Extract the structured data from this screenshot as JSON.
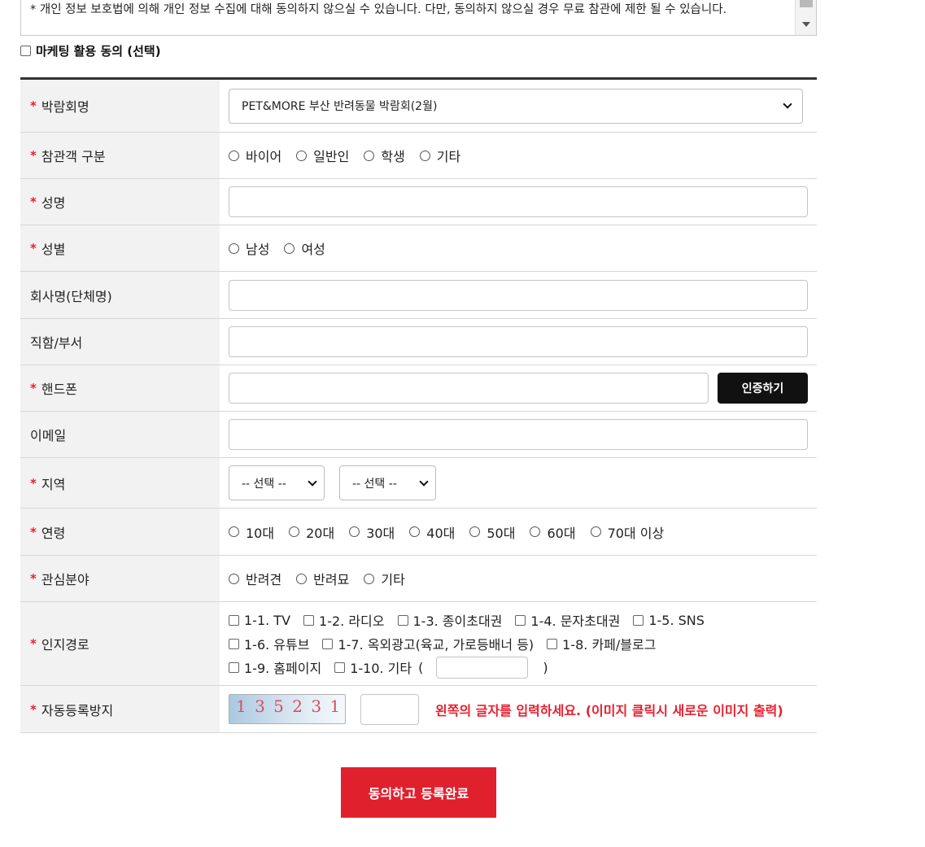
{
  "notice": {
    "text": "* 개인 정보 보호법에 의해 개인 정보 수집에 대해 동의하지 않으실 수 있습니다. 다만, 동의하지 않으실 경우 무료 참관에 제한 될 수 있습니다."
  },
  "marketing": {
    "label": "마케팅 활용 동의 (선택)"
  },
  "form": {
    "expo": {
      "label": "박람회명",
      "selected": "PET&MORE 부산 반려동물 박람회(2월)"
    },
    "visitor_type": {
      "label": "참관객 구분",
      "options": [
        "바이어",
        "일반인",
        "학생",
        "기타"
      ]
    },
    "name": {
      "label": "성명"
    },
    "gender": {
      "label": "성별",
      "options": [
        "남성",
        "여성"
      ]
    },
    "company": {
      "label": "회사명(단체명)"
    },
    "position": {
      "label": "직함/부서"
    },
    "phone": {
      "label": "핸드폰",
      "verify_label": "인증하기"
    },
    "email": {
      "label": "이메일"
    },
    "region": {
      "label": "지역",
      "select1": "-- 선택 --",
      "select2": "-- 선택 --"
    },
    "age": {
      "label": "연령",
      "options": [
        "10대",
        "20대",
        "30대",
        "40대",
        "50대",
        "60대",
        "70대 이상"
      ]
    },
    "interest": {
      "label": "관심분야",
      "options": [
        "반려견",
        "반려묘",
        "기타"
      ]
    },
    "path": {
      "label": "인지경로",
      "line1": [
        "1-1. TV",
        "1-2. 라디오",
        "1-3. 종이초대권",
        "1-4. 문자초대권",
        "1-5. SNS"
      ],
      "line2": [
        "1-6. 유튜브",
        "1-7. 옥외광고(육교, 가로등배너 등)",
        "1-8. 카페/블로그"
      ],
      "line3": [
        "1-9. 홈페이지",
        "1-10. 기타"
      ],
      "paren_open": "(",
      "paren_close": ")"
    },
    "captcha": {
      "label": "자동등록방지",
      "image_text": "1 3 5 2 3 1",
      "message": "왼쪽의 글자를 입력하세요. (이미지 클릭시 새로운 이미지 출력)"
    }
  },
  "submit": {
    "label": "동의하고 등록완료"
  },
  "colors": {
    "accent_red": "#e1202e",
    "required_star": "#e8202f",
    "dark_button": "#111111"
  }
}
